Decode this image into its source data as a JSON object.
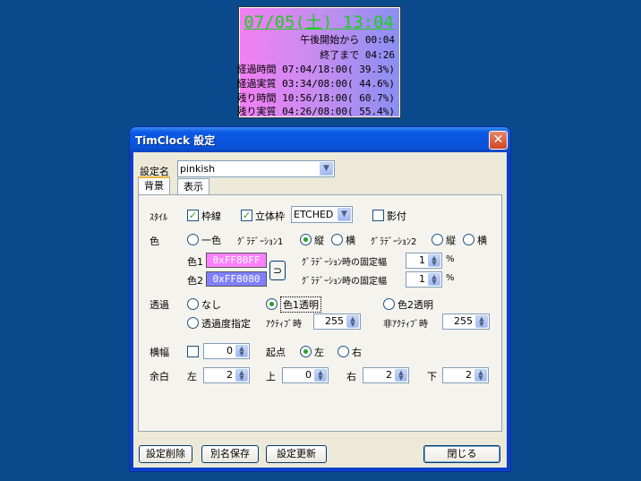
{
  "clock": {
    "time": "07/05(土) 13:04",
    "lines": [
      "午後開始から 00:04",
      "終了まで 04:26",
      "経過時間 07:04/18:00( 39.3%)",
      "経過実質 03:34/08:00( 44.6%)",
      "残り時間 10:56/18:00( 60.7%)",
      "残り実質 04:26/08:00( 55.4%)"
    ],
    "colors": {
      "time": "#1bd01b",
      "gradient_start": "#f27ff2",
      "gradient_end": "#8b8ff2"
    }
  },
  "window": {
    "title": "TimClock 設定",
    "close_icon": "close-icon",
    "setting_name_label": "設定名",
    "setting_name_value": "pinkish",
    "tabs": [
      {
        "label": "背景",
        "active": true
      },
      {
        "label": "表示",
        "active": false
      }
    ],
    "style": {
      "label": "ｽﾀｲﾙ",
      "border": {
        "label": "枠線",
        "checked": true
      },
      "bevel": {
        "label": "立体枠",
        "checked": true
      },
      "bevel_type": "ETCHED",
      "shadow": {
        "label": "影付",
        "checked": false
      }
    },
    "color": {
      "label": "色",
      "single": "一色",
      "grad1": "ｸﾞﾗﾃﾞｰｼｮﾝ1",
      "grad2": "ｸﾞﾗﾃﾞｰｼｮﾝ2",
      "vertical": "縦",
      "horizontal": "横",
      "color1_label": "色1",
      "color1_value": "0xFF80FF",
      "color2_label": "色2",
      "color2_value": "0xFF8080",
      "swap": "⊃",
      "fixed_width_label": "ｸﾞﾗﾃﾞｰｼｮﾝ時の固定幅",
      "fixed_width1": "1",
      "fixed_width2": "1",
      "percent": "%",
      "colors": {
        "color1": "#ff80ff",
        "color2": "#8080ff"
      }
    },
    "transparency": {
      "label": "透過",
      "none": "なし",
      "color1": "色1透明",
      "color2": "色2透明",
      "level": "透過度指定",
      "active_label": "ｱｸﾃｨﾌﾞ時",
      "active_value": "255",
      "inactive_label": "非ｱｸﾃｨﾌﾞ時",
      "inactive_value": "255"
    },
    "width": {
      "label": "横幅",
      "value": "0",
      "origin_label": "起点",
      "left": "左",
      "right": "右"
    },
    "margin": {
      "label": "余白",
      "left_label": "左",
      "left_value": "2",
      "top_label": "上",
      "top_value": "0",
      "right_label": "右",
      "right_value": "2",
      "bottom_label": "下",
      "bottom_value": "2"
    },
    "buttons": {
      "delete": "設定削除",
      "save_as": "別名保存",
      "update": "設定更新",
      "close": "閉じる"
    }
  }
}
